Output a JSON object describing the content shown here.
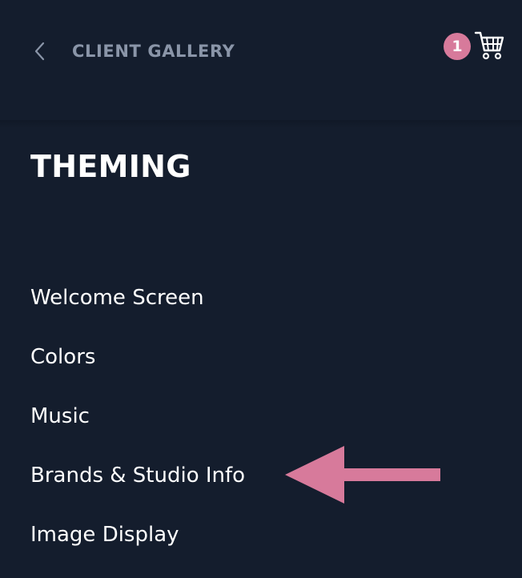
{
  "header": {
    "back_label": "CLIENT GALLERY",
    "back_icon": "chevron-left-icon",
    "cart": {
      "badge_count": "1",
      "icon": "shopping-cart-icon"
    }
  },
  "section": {
    "title": "THEMING"
  },
  "menu": {
    "items": [
      {
        "label": "Welcome Screen"
      },
      {
        "label": "Colors"
      },
      {
        "label": "Music"
      },
      {
        "label": "Brands & Studio Info"
      },
      {
        "label": "Image Display"
      }
    ]
  },
  "annotation": {
    "type": "arrow-pointing-left",
    "target": "Brands & Studio Info"
  },
  "colors": {
    "background": "#141d2d",
    "back_label": "#8a95a8",
    "badge": "#d77a9b",
    "arrow": "#d77a9b",
    "text": "#ffffff"
  }
}
